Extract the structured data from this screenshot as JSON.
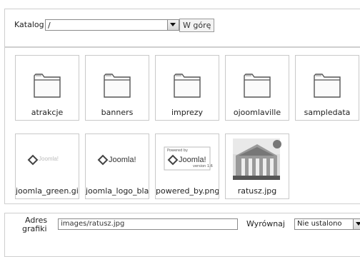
{
  "catalog": {
    "label": "Katalog",
    "selected": "/",
    "up_button": "W górę"
  },
  "items": [
    {
      "name": "atrakcje",
      "icon": "folder-icon"
    },
    {
      "name": "banners",
      "icon": "folder-icon"
    },
    {
      "name": "imprezy",
      "icon": "folder-icon"
    },
    {
      "name": "ojoomlaville",
      "icon": "folder-icon"
    },
    {
      "name": "sampledata",
      "icon": "folder-icon"
    },
    {
      "name": "joomla_green.gif",
      "icon": "image-thumbnail",
      "logo_text": "Joomla!"
    },
    {
      "name": "joomla_logo_blac",
      "icon": "image-thumbnail",
      "logo_text": "Joomla!"
    },
    {
      "name": "powered_by.png",
      "icon": "image-thumbnail",
      "logo_text": "Joomla!",
      "small_top": "Powered by",
      "small_bottom": "version 1.6"
    },
    {
      "name": "ratusz.jpg",
      "icon": "photo-thumbnail"
    }
  ],
  "url": {
    "label_line1": "Adres",
    "label_line2": "grafiki",
    "value": "images/ratusz.jpg",
    "align_label": "Wyrównaj",
    "align_value": "Nie ustalono"
  }
}
